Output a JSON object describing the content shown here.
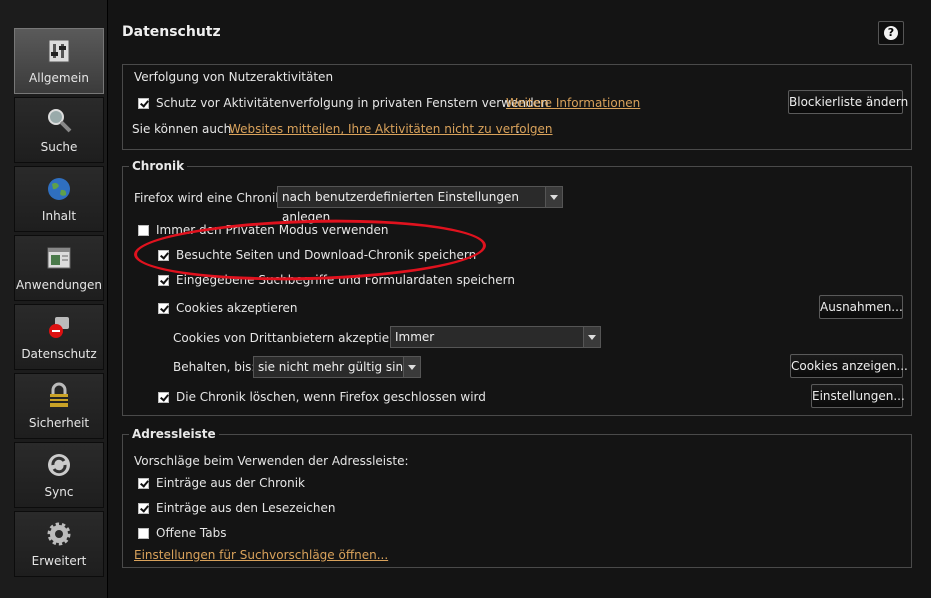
{
  "sidebar": {
    "items": [
      {
        "label": "Allgemein",
        "icon": "switch-icon",
        "active": true
      },
      {
        "label": "Suche",
        "icon": "magnifier-icon",
        "active": false
      },
      {
        "label": "Inhalt",
        "icon": "globe-icon",
        "active": false
      },
      {
        "label": "Anwendungen",
        "icon": "window-icon",
        "active": false
      },
      {
        "label": "Datenschutz",
        "icon": "privacy-mask-icon",
        "active": false
      },
      {
        "label": "Sicherheit",
        "icon": "padlock-icon",
        "active": false
      },
      {
        "label": "Sync",
        "icon": "sync-icon",
        "active": false
      },
      {
        "label": "Erweitert",
        "icon": "gear-icon",
        "active": false
      }
    ]
  },
  "page": {
    "title": "Datenschutz",
    "help_label": "?"
  },
  "tracking": {
    "legend": "Verfolgung von Nutzeraktivitäten",
    "dnt_label": "Schutz vor Aktivitätenverfolgung in privaten Fenstern verwenden",
    "dnt_checked": true,
    "more_info_link": "Weitere Informationen",
    "blocklist_button": "Blockierliste ändern",
    "sentence_prefix": "Sie können auch",
    "sentence_link": "Websites mitteilen, Ihre Aktivitäten nicht zu verfolgen",
    "sentence_suffix": "."
  },
  "history": {
    "legend": "Chronik",
    "mode_label": "Firefox wird eine Chronik:",
    "mode_value": "nach benutzerdefinierten Einstellungen anlegen",
    "private_mode_label": "Immer den Privaten Modus verwenden",
    "private_mode_checked": false,
    "remember_history_label": "Besuchte Seiten und Download-Chronik speichern",
    "remember_history_checked": true,
    "remember_forms_label": "Eingegebene Suchbegriffe und Formulardaten speichern",
    "remember_forms_checked": true,
    "accept_cookies_label": "Cookies akzeptieren",
    "accept_cookies_checked": true,
    "exceptions_button": "Ausnahmen...",
    "third_party_label": "Cookies von Drittanbietern akzeptieren:",
    "third_party_value": "Immer",
    "keep_until_label": "Behalten, bis:",
    "keep_until_value": "sie nicht mehr gültig sind",
    "show_cookies_button": "Cookies anzeigen...",
    "clear_on_close_label": "Die Chronik löschen, wenn Firefox geschlossen wird",
    "clear_on_close_checked": true,
    "settings_button": "Einstellungen..."
  },
  "location_bar": {
    "legend": "Adressleiste",
    "intro": "Vorschläge beim Verwenden der Adressleiste:",
    "history_label": "Einträge aus der Chronik",
    "history_checked": true,
    "bookmarks_label": "Einträge aus den Lesezeichen",
    "bookmarks_checked": true,
    "open_tabs_label": "Offene Tabs",
    "open_tabs_checked": false,
    "suggest_settings_link": "Einstellungen für Suchvorschläge öffnen..."
  },
  "colors": {
    "accent_link": "#d9a25b",
    "annotation_red": "#e0121e",
    "background": "#141414"
  }
}
